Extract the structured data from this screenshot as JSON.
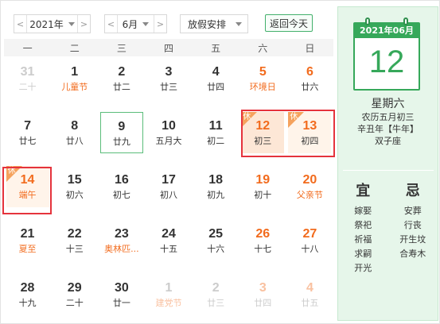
{
  "toolbar": {
    "year_value": "2021年",
    "month_value": "6月",
    "holiday_label": "放假安排",
    "today_label": "返回今天",
    "prev_glyph": "<",
    "next_glyph": ">"
  },
  "weekdays": [
    "一",
    "二",
    "三",
    "四",
    "五",
    "六",
    "日"
  ],
  "rest_badge": "休",
  "days": [
    {
      "num": "31",
      "lunar": "二十",
      "other": true
    },
    {
      "num": "1",
      "lunar": "儿童节",
      "hl": true
    },
    {
      "num": "2",
      "lunar": "廿二"
    },
    {
      "num": "3",
      "lunar": "廿三"
    },
    {
      "num": "4",
      "lunar": "廿四"
    },
    {
      "num": "5",
      "lunar": "环境日",
      "hl": true,
      "wk": true
    },
    {
      "num": "6",
      "lunar": "廿六",
      "wk": true
    },
    {
      "num": "7",
      "lunar": "廿七"
    },
    {
      "num": "8",
      "lunar": "廿八"
    },
    {
      "num": "9",
      "lunar": "廿九",
      "today": true
    },
    {
      "num": "10",
      "lunar": "五月大"
    },
    {
      "num": "11",
      "lunar": "初二"
    },
    {
      "num": "12",
      "lunar": "初三",
      "wk": true,
      "rest": true,
      "sel": true
    },
    {
      "num": "13",
      "lunar": "初四",
      "wk": true,
      "rest": true
    },
    {
      "num": "14",
      "lunar": "端午",
      "hl": true,
      "wk": true,
      "rest": true
    },
    {
      "num": "15",
      "lunar": "初六"
    },
    {
      "num": "16",
      "lunar": "初七"
    },
    {
      "num": "17",
      "lunar": "初八"
    },
    {
      "num": "18",
      "lunar": "初九"
    },
    {
      "num": "19",
      "lunar": "初十",
      "wk": true
    },
    {
      "num": "20",
      "lunar": "父亲节",
      "hl": true,
      "wk": true
    },
    {
      "num": "21",
      "lunar": "夏至",
      "hl": true
    },
    {
      "num": "22",
      "lunar": "十三"
    },
    {
      "num": "23",
      "lunar": "奥林匹...",
      "hl": true
    },
    {
      "num": "24",
      "lunar": "十五"
    },
    {
      "num": "25",
      "lunar": "十六"
    },
    {
      "num": "26",
      "lunar": "十七",
      "wk": true
    },
    {
      "num": "27",
      "lunar": "十八",
      "wk": true
    },
    {
      "num": "28",
      "lunar": "十九"
    },
    {
      "num": "29",
      "lunar": "二十"
    },
    {
      "num": "30",
      "lunar": "廿一"
    },
    {
      "num": "1",
      "lunar": "建党节",
      "hl": true,
      "other": true
    },
    {
      "num": "2",
      "lunar": "廿三",
      "other": true
    },
    {
      "num": "3",
      "lunar": "廿四",
      "other": true,
      "wk": true
    },
    {
      "num": "4",
      "lunar": "廿五",
      "other": true,
      "wk": true
    }
  ],
  "panel": {
    "header": "2021年06月",
    "big_day": "12",
    "weekday": "星期六",
    "lunar_date": "农历五月初三",
    "ganzhi": "辛丑年【牛年】",
    "zodiac": "双子座",
    "yi_title": "宜",
    "ji_title": "忌",
    "yi": [
      "嫁娶",
      "祭祀",
      "祈福",
      "求嗣",
      "开光"
    ],
    "ji": [
      "安葬",
      "行丧",
      "开生坟",
      "合寿木"
    ]
  },
  "colors": {
    "weekend": "#f26b1d",
    "accent_green": "#36a85a",
    "rest_badge": "#f5a25d",
    "highlight_border": "#e5333c"
  }
}
